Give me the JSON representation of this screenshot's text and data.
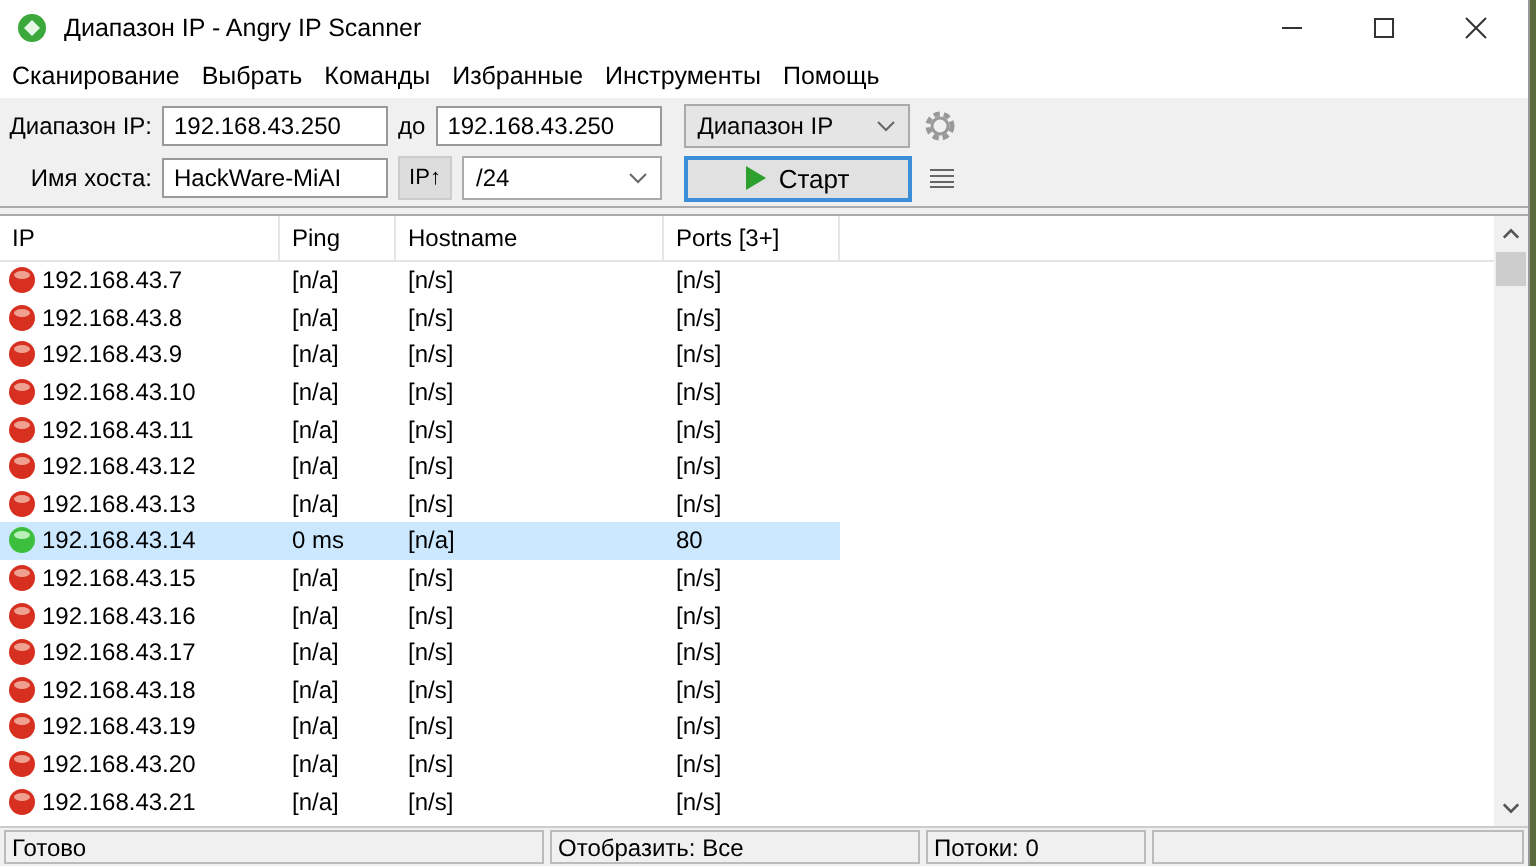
{
  "window": {
    "title": "Диапазон IP - Angry IP Scanner"
  },
  "menu": [
    "Сканирование",
    "Выбрать",
    "Команды",
    "Избранные",
    "Инструменты",
    "Помощь"
  ],
  "toolbar": {
    "range_label": "Диапазон IP:",
    "range_from": "192.168.43.250",
    "to_label": "до",
    "range_to": "192.168.43.250",
    "feeder": "Диапазон IP",
    "hostname_label": "Имя хоста:",
    "hostname": "HackWare-MiAI",
    "ip_button": "IP↑",
    "netmask": "/24",
    "start_button": "Старт"
  },
  "table": {
    "columns": [
      "IP",
      "Ping",
      "Hostname",
      "Ports [3+]"
    ],
    "rows": [
      {
        "ip": "192.168.43.7",
        "ping": "[n/a]",
        "hostname": "[n/s]",
        "ports": "[n/s]",
        "alive": false,
        "selected": false
      },
      {
        "ip": "192.168.43.8",
        "ping": "[n/a]",
        "hostname": "[n/s]",
        "ports": "[n/s]",
        "alive": false,
        "selected": false
      },
      {
        "ip": "192.168.43.9",
        "ping": "[n/a]",
        "hostname": "[n/s]",
        "ports": "[n/s]",
        "alive": false,
        "selected": false
      },
      {
        "ip": "192.168.43.10",
        "ping": "[n/a]",
        "hostname": "[n/s]",
        "ports": "[n/s]",
        "alive": false,
        "selected": false
      },
      {
        "ip": "192.168.43.11",
        "ping": "[n/a]",
        "hostname": "[n/s]",
        "ports": "[n/s]",
        "alive": false,
        "selected": false
      },
      {
        "ip": "192.168.43.12",
        "ping": "[n/a]",
        "hostname": "[n/s]",
        "ports": "[n/s]",
        "alive": false,
        "selected": false
      },
      {
        "ip": "192.168.43.13",
        "ping": "[n/a]",
        "hostname": "[n/s]",
        "ports": "[n/s]",
        "alive": false,
        "selected": false
      },
      {
        "ip": "192.168.43.14",
        "ping": "0 ms",
        "hostname": "[n/a]",
        "ports": "80",
        "alive": true,
        "selected": true
      },
      {
        "ip": "192.168.43.15",
        "ping": "[n/a]",
        "hostname": "[n/s]",
        "ports": "[n/s]",
        "alive": false,
        "selected": false
      },
      {
        "ip": "192.168.43.16",
        "ping": "[n/a]",
        "hostname": "[n/s]",
        "ports": "[n/s]",
        "alive": false,
        "selected": false
      },
      {
        "ip": "192.168.43.17",
        "ping": "[n/a]",
        "hostname": "[n/s]",
        "ports": "[n/s]",
        "alive": false,
        "selected": false
      },
      {
        "ip": "192.168.43.18",
        "ping": "[n/a]",
        "hostname": "[n/s]",
        "ports": "[n/s]",
        "alive": false,
        "selected": false
      },
      {
        "ip": "192.168.43.19",
        "ping": "[n/a]",
        "hostname": "[n/s]",
        "ports": "[n/s]",
        "alive": false,
        "selected": false
      },
      {
        "ip": "192.168.43.20",
        "ping": "[n/a]",
        "hostname": "[n/s]",
        "ports": "[n/s]",
        "alive": false,
        "selected": false
      },
      {
        "ip": "192.168.43.21",
        "ping": "[n/a]",
        "hostname": "[n/s]",
        "ports": "[n/s]",
        "alive": false,
        "selected": false
      }
    ]
  },
  "status_bar": {
    "status": "Готово",
    "display": "Отобразить: Все",
    "threads": "Потоки: 0",
    "progress": {
      "level": 0
    }
  }
}
